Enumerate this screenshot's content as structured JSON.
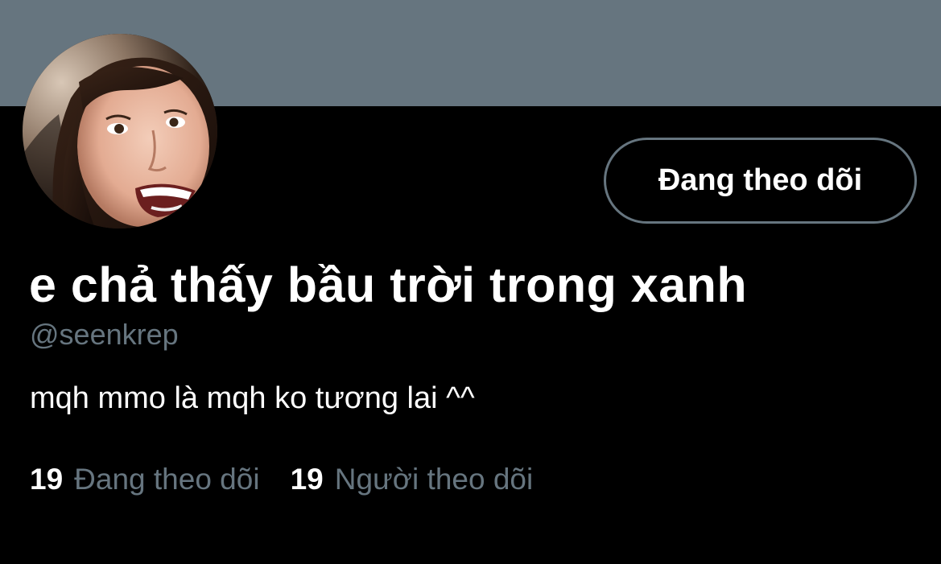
{
  "colors": {
    "banner": "#66757f",
    "background": "#000000",
    "text_primary": "#ffffff",
    "text_secondary": "#66757f",
    "button_border": "#66757f"
  },
  "profile": {
    "avatar_icon": "profile-photo",
    "display_name": "e chả thấy bầu trời trong xanh",
    "handle": "@seenkrep",
    "bio": "mqh mmo là mqh ko tương lai ^^",
    "follow_button_label": "Đang theo dõi"
  },
  "stats": {
    "following": {
      "count": "19",
      "label": "Đang theo dõi"
    },
    "followers": {
      "count": "19",
      "label": "Người theo dõi"
    }
  }
}
